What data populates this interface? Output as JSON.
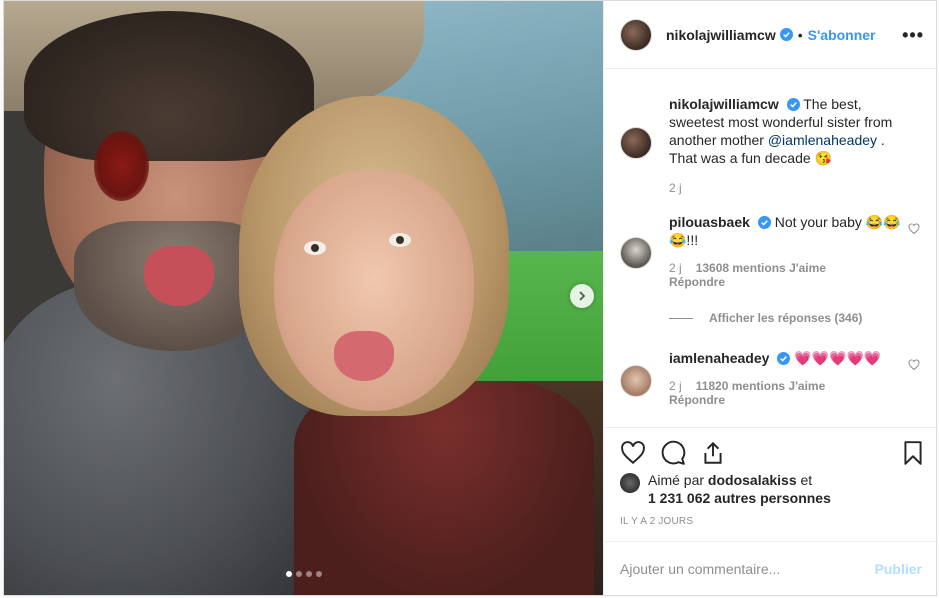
{
  "post": {
    "username": "nikolajwilliamcw",
    "follow_label": "S'abonner",
    "separator": "•",
    "more_label": "•••",
    "carousel": {
      "slide_count": 4,
      "active_index": 0
    }
  },
  "caption": {
    "username": "nikolajwilliamcw",
    "text_before": "The best, sweetest most wonderful sister from another mother ",
    "mention": "@iamlenaheadey",
    "text_after": " . That was a fun decade 😘",
    "age": "2 j"
  },
  "comments": [
    {
      "username": "pilouasbaek",
      "text": "Not your baby 😂😂😂!!!",
      "age": "2 j",
      "likes": "13608 mentions J'aime",
      "reply_label": "Répondre"
    },
    {
      "username": "iamlenaheadey",
      "text": "💗💗💗💗💗",
      "age": "2 j",
      "likes": "11820 mentions J'aime",
      "reply_label": "Répondre"
    }
  ],
  "view_replies_label": "Afficher les réponses (346)",
  "likes_summary": {
    "prefix": "Aimé par ",
    "user": "dodosalakiss",
    "middle": " et",
    "others": "1 231 062 autres personnes"
  },
  "timestamp": "IL Y A 2 JOURS",
  "add_comment": {
    "placeholder": "Ajouter un commentaire...",
    "value": "",
    "publish_label": "Publier"
  },
  "colors": {
    "link": "#3897f0",
    "verified": "#3897f0",
    "publish_disabled": "#b2dffc"
  }
}
